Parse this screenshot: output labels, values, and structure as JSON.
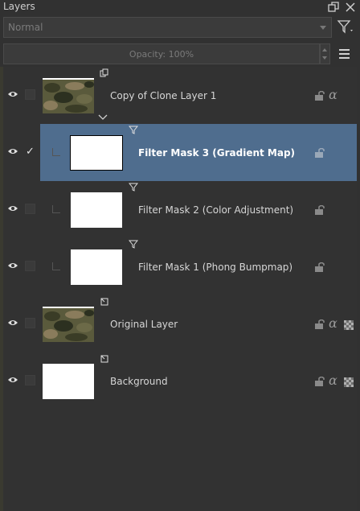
{
  "panel": {
    "title": "Layers",
    "blending_mode": "Normal",
    "opacity_label": "Opacity:  100%"
  },
  "layers": [
    {
      "name": "Copy of Clone Layer 1",
      "type": "clone-layer",
      "visible": true,
      "selected": false,
      "thumb": "camo",
      "locked": false,
      "alpha_lock": true,
      "inherit_alpha": false,
      "expanded": true
    },
    {
      "name": "Filter Mask 3 (Gradient Map)",
      "type": "filter-mask",
      "visible": true,
      "selected": true,
      "checked": true,
      "thumb": "white"
    },
    {
      "name": "Filter Mask 2 (Color Adjustment)",
      "type": "filter-mask",
      "visible": true,
      "selected": false,
      "thumb": "white"
    },
    {
      "name": "Filter Mask 1 (Phong Bumpmap)",
      "type": "filter-mask",
      "visible": true,
      "selected": false,
      "thumb": "white"
    },
    {
      "name": "Original Layer",
      "type": "paint-layer",
      "visible": true,
      "selected": false,
      "thumb": "camo",
      "alpha_lock": true,
      "inherit_alpha": true
    },
    {
      "name": "Background",
      "type": "paint-layer",
      "visible": true,
      "selected": false,
      "thumb": "white",
      "alpha_lock": true,
      "inherit_alpha": true
    }
  ],
  "colors": {
    "panel_bg": "#313131",
    "selection": "#4f6d8e",
    "text": "#d6d6d6",
    "muted": "#7a7a7a"
  }
}
